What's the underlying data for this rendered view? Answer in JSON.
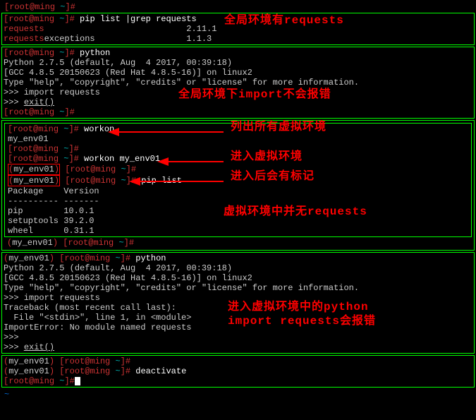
{
  "prompt": {
    "user": "root",
    "sep": "@",
    "host": "ming",
    "path": " ~",
    "suffix": "]#"
  },
  "venv_tag": "(my_env01)",
  "box1": {
    "cmd": "pip list |grep requests",
    "row1_pkg": "requests",
    "row1_ver": "2.11.1",
    "row2_pkg": "requests",
    "row2_rest": "exceptions",
    "row2_ver": "1.1.3"
  },
  "callout1": "全局环境有requests",
  "box2": {
    "cmd": "python",
    "l1": "Python 2.7.5 (default, Aug  4 2017, 00:39:18)",
    "l2": "[GCC 4.8.5 20150623 (Red Hat 4.8.5-16)] on linux2",
    "l3": "Type \"help\", \"copyright\", \"credits\" or \"license\" for more information.",
    "l4": ">>> import requests",
    "l5": ">>> ",
    "l5u": "exit()"
  },
  "callout2": "全局环境下import不会报错",
  "box3": {
    "cmd1": "workon",
    "env": "my_env01",
    "cmd2": "workon my_env01",
    "cmd3": "pip list",
    "hdr": "Package    Version",
    "sep": "---------- -------",
    "r1": "pip        10.0.1",
    "r2": "setuptools 39.2.0",
    "r3": "wheel      0.31.1"
  },
  "call3a": "列出所有虚拟环境",
  "call3b": "进入虚拟环境",
  "call3c": "进入后会有标记",
  "call3d": "虚拟环境中并无requests",
  "box4": {
    "cmd": "python",
    "l1": "Python 2.7.5 (default, Aug  4 2017, 00:39:18)",
    "l2": "[GCC 4.8.5 20150623 (Red Hat 4.8.5-16)] on linux2",
    "l3": "Type \"help\", \"copyright\", \"credits\" or \"license\" for more information.",
    "l4": ">>> import requests",
    "l5": "Traceback (most recent call last):",
    "l6": "  File \"<stdin>\", line 1, in <module>",
    "l7": "ImportError: No module named requests",
    "l8": ">>>",
    "l9": ">>> ",
    "l9u": "exit()"
  },
  "call4a": "进入虚拟环境中的python",
  "call4b": "import requests会报错",
  "box5": {
    "cmd": "deactivate"
  },
  "tilde": "~"
}
